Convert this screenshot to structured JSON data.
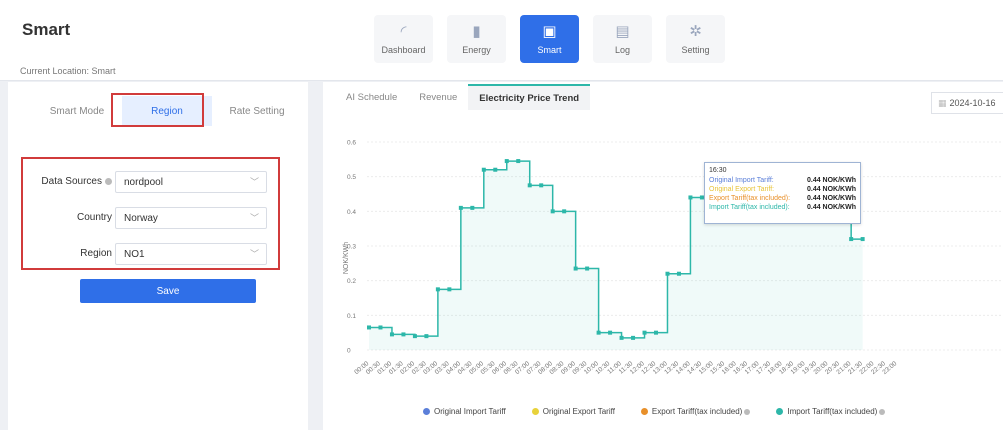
{
  "app": {
    "title": "Smart",
    "location": "Current Location: Smart"
  },
  "nav": [
    {
      "label": "Dashboard",
      "icon": "gauge-icon",
      "glyph": "◜"
    },
    {
      "label": "Energy",
      "icon": "bar-chart-icon",
      "glyph": "▮"
    },
    {
      "label": "Smart",
      "icon": "calendar-check-icon",
      "glyph": "▣"
    },
    {
      "label": "Log",
      "icon": "document-icon",
      "glyph": "▤"
    },
    {
      "label": "Setting",
      "icon": "gear-icon",
      "glyph": "✲"
    }
  ],
  "mode_tabs": [
    "Smart Mode",
    "Region",
    "Rate Setting"
  ],
  "form": {
    "data_sources": {
      "label": "Data Sources",
      "value": "nordpool"
    },
    "country": {
      "label": "Country",
      "value": "Norway"
    },
    "region": {
      "label": "Region",
      "value": "NO1"
    },
    "save": "Save"
  },
  "chart_tabs": [
    "AI Schedule",
    "Revenue",
    "Electricity Price Trend"
  ],
  "date": "2024-10-16",
  "tooltip": {
    "time": "16:30",
    "rows": [
      {
        "name": "Original Import Tariff:",
        "value": "0.44 NOK/KWh",
        "color": "#5b7fd9"
      },
      {
        "name": "Original Export Tariff:",
        "value": "0.44 NOK/KWh",
        "color": "#e8c43a"
      },
      {
        "name": "Export Tariff(tax included):",
        "value": "0.44 NOK/KWh",
        "color": "#e8902a"
      },
      {
        "name": "Import Tariff(tax included):",
        "value": "0.44 NOK/KWh",
        "color": "#2db7a9"
      }
    ]
  },
  "legend": [
    {
      "name": "Original Import Tariff",
      "color": "#5b7fd9",
      "help": false
    },
    {
      "name": "Original Export Tariff",
      "color": "#e8d23a",
      "help": false
    },
    {
      "name": "Export Tariff(tax included)",
      "color": "#e8902a",
      "help": true
    },
    {
      "name": "Import Tariff(tax included)",
      "color": "#2db7a9",
      "help": true
    }
  ],
  "chart_data": {
    "type": "line",
    "ylabel": "NOK/KWh",
    "ylim": [
      0,
      0.6
    ],
    "yticks": [
      "0",
      "0.1",
      "0.2",
      "0.3",
      "0.4",
      "0.5",
      "0.6"
    ],
    "x": [
      "00:00",
      "00:30",
      "01:00",
      "01:30",
      "02:00",
      "02:30",
      "03:00",
      "03:30",
      "04:00",
      "04:30",
      "05:00",
      "05:30",
      "06:00",
      "06:30",
      "07:00",
      "07:30",
      "08:00",
      "08:30",
      "09:00",
      "09:30",
      "10:00",
      "10:30",
      "11:00",
      "11:30",
      "12:00",
      "12:30",
      "13:00",
      "13:30",
      "14:00",
      "14:30",
      "15:00",
      "15:30",
      "16:00",
      "16:30",
      "17:00",
      "17:30",
      "18:00",
      "18:30",
      "19:00",
      "19:30",
      "20:00",
      "20:30",
      "21:00",
      "21:30",
      "22:00",
      "22:30",
      "23:00"
    ],
    "series": [
      {
        "name": "Import Tariff(tax included)",
        "color": "#2db7a9",
        "values": [
          0.065,
          0.065,
          0.045,
          0.045,
          0.04,
          0.04,
          0.175,
          0.175,
          0.41,
          0.41,
          0.52,
          0.52,
          0.545,
          0.545,
          0.475,
          0.475,
          0.4,
          0.4,
          0.235,
          0.235,
          0.05,
          0.05,
          0.035,
          0.035,
          0.05,
          0.05,
          0.22,
          0.22,
          0.44,
          0.44,
          0.44,
          0.44,
          0.44,
          0.44,
          0.43,
          0.43,
          0.425,
          0.425,
          0.41,
          0.41,
          0.385,
          0.385,
          0.32,
          0.32
        ]
      }
    ]
  }
}
